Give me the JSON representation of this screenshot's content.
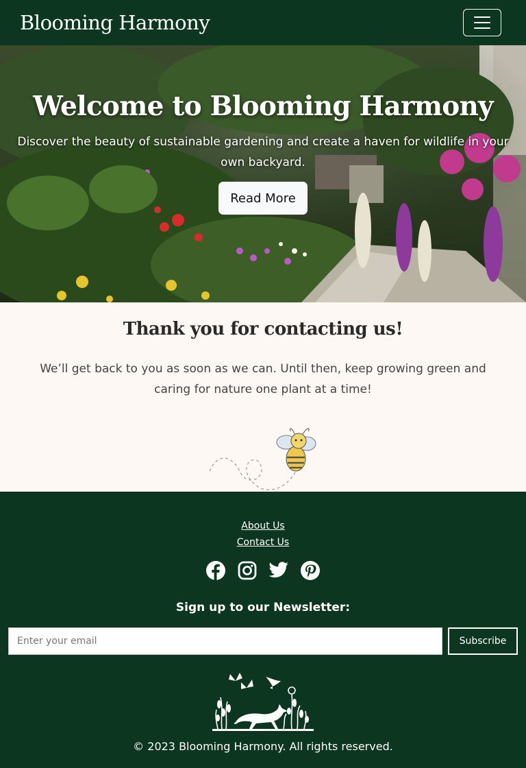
{
  "navbar": {
    "brand": "Blooming Harmony",
    "toggle_icon": "hamburger-menu-icon"
  },
  "hero": {
    "title": "Welcome to Blooming Harmony",
    "subtitle": "Discover the beauty of sustainable gardening and create a haven for wildlife in your own backyard.",
    "button_label": "Read More"
  },
  "thanks": {
    "title": "Thank you for contacting us!",
    "text": "We’ll get back to you as soon as we can. Until then, keep growing green and caring for nature one plant at a time!",
    "illustration": "bee-icon"
  },
  "footer": {
    "links": [
      "About Us",
      "Contact Us"
    ],
    "social_icons": [
      "facebook-icon",
      "instagram-icon",
      "twitter-icon",
      "pinterest-icon"
    ],
    "newsletter_title": "Sign up to our Newsletter:",
    "email_placeholder": "Enter your email",
    "subscribe_label": "Subscribe",
    "illustration": "wildlife-icon",
    "copyright": "© 2023 Blooming Harmony. All rights reserved."
  },
  "colors": {
    "brand_green": "#0c3620",
    "cream": "#fdf8f4"
  }
}
